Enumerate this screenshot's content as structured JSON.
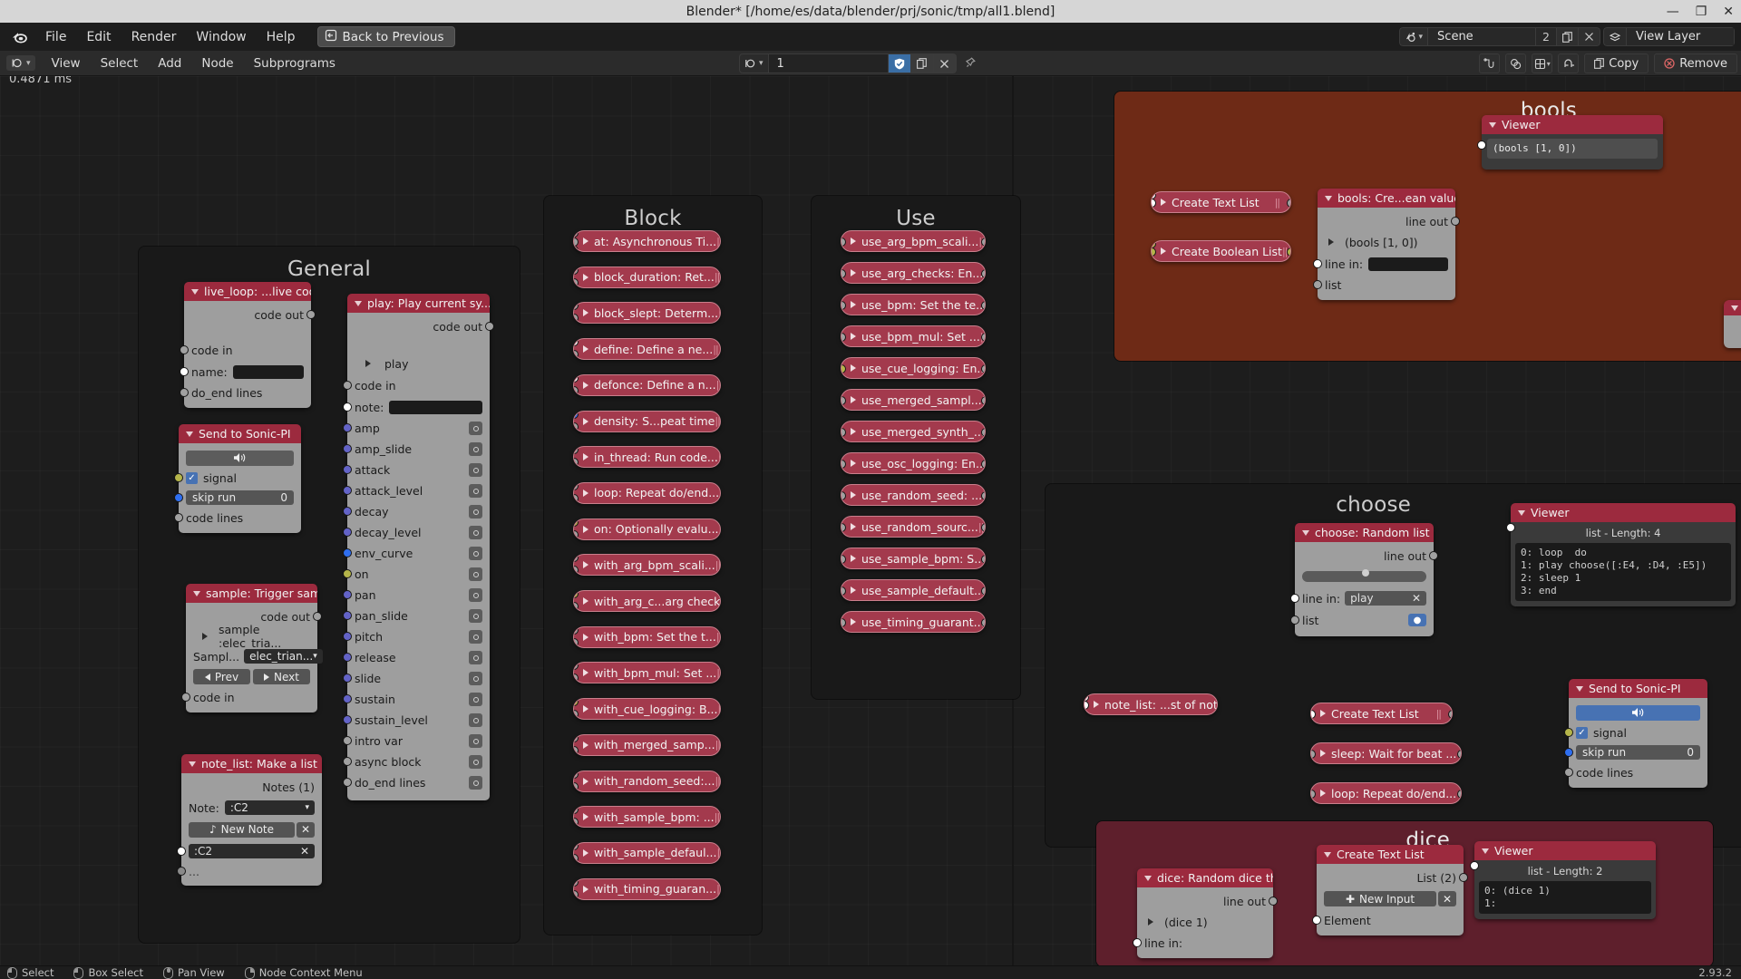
{
  "window": {
    "title": "Blender* [/home/es/data/blender/prj/sonic/tmp/all1.blend]",
    "minimize": "—",
    "maximize": "❐",
    "close": "✕"
  },
  "topbar": {
    "menus": [
      "File",
      "Edit",
      "Render",
      "Window",
      "Help"
    ],
    "back_button": "Back to Previous",
    "scene_name": "Scene",
    "scene_users": "2",
    "scene_copy_icon": "copy-icon",
    "scene_delete_icon": "x-icon",
    "view_layer_name": "View Layer"
  },
  "editor_header": {
    "menus": [
      "View",
      "Select",
      "Add",
      "Node",
      "Subprograms"
    ],
    "nodetree_name": "1",
    "fake_user_icon": "shield-icon",
    "new_copy_icon": "copy-icon",
    "unlink_icon": "x-icon",
    "pin_icon": "pin-icon",
    "copy_label": "Copy",
    "remove_label": "Remove"
  },
  "canvas": {
    "timing_label": "0.4871 ms"
  },
  "statusbar": {
    "items": [
      "Select",
      "Box Select",
      "Pan View",
      "Node Context Menu"
    ],
    "version": "2.93.2"
  },
  "frames": {
    "general": {
      "title": "General"
    },
    "block": {
      "title": "Block"
    },
    "use": {
      "title": "Use"
    },
    "bools": {
      "title": "bools"
    },
    "choose": {
      "title": "choose"
    },
    "dice": {
      "title": "dice"
    }
  },
  "nodes": {
    "live_loop": {
      "title": "live_loop: ...live coding",
      "out_code": "code out",
      "in_code": "code in",
      "name_label": "name:",
      "name_value": "",
      "do_end": "do_end lines"
    },
    "send_sonic_pi_1": {
      "title": "Send to Sonic-PI",
      "play_icon": "speaker-icon",
      "signal_label": "signal",
      "signal_checked": true,
      "skip_run_label": "skip run",
      "skip_run_value": "0",
      "code_lines": "code lines"
    },
    "sample": {
      "title": "sample: Trigger sam...",
      "out_code": "code out",
      "expand_label": "sample :elec_tria...",
      "sample_label": "Sampl...",
      "sample_value": "elec_trian...",
      "prev_label": "Prev",
      "next_label": "Next",
      "in_code": "code in"
    },
    "note_list": {
      "title": "note_list: Make a list ...",
      "notes_count": "Notes (1)",
      "note_label": "Note:",
      "note_value": ":C2",
      "new_note_label": "New Note",
      "item_value": ":C2",
      "more": "..."
    },
    "play": {
      "title": "play: Play current sy...",
      "out_code": "code out",
      "expand_label": "play",
      "in_code": "code in",
      "note_label": "note:",
      "note_value": "",
      "params": [
        "amp",
        "amp_slide",
        "attack",
        "attack_level",
        "decay",
        "decay_level",
        "env_curve",
        "on",
        "pan",
        "pan_slide",
        "pitch",
        "release",
        "slide",
        "sustain",
        "sustain_level",
        "intro var",
        "async block",
        "do_end lines"
      ]
    },
    "bools_node": {
      "title": "bools: Cre...ean values",
      "line_out": "line out",
      "value": "(bools [1, 0])",
      "line_in_label": "line in:",
      "line_in_value": "",
      "list_label": "list"
    },
    "bools_viewer": {
      "title": "Viewer",
      "text": "(bools [1, 0])"
    },
    "create_text_list_bools": {
      "title": "Create Text List"
    },
    "create_boolean_list": {
      "title": "Create Boolean List"
    },
    "choose_node": {
      "title": "choose: Random list ...",
      "line_out": "line out",
      "line_in_label": "line in:",
      "line_in_value": "play",
      "list_label": "list"
    },
    "choose_viewer": {
      "title": "Viewer",
      "subtitle": "list - Length: 4",
      "text": "0: loop  do\n1: play choose([:E4, :D4, :E5])\n2: sleep 1\n3: end"
    },
    "note_list_choose": {
      "title": "note_list: ...st of notes"
    },
    "create_text_list_choose": {
      "title": "Create Text List"
    },
    "sleep_node": {
      "title": "sleep: Wait for beat ..."
    },
    "loop_node": {
      "title": "loop: Repeat do/end..."
    },
    "send_sonic_pi_2": {
      "title": "Send to Sonic-PI",
      "signal_label": "signal",
      "signal_checked": true,
      "skip_run_label": "skip run",
      "skip_run_value": "0",
      "code_lines": "code lines"
    },
    "dice_node": {
      "title": "dice: Random dice th...",
      "line_out": "line out",
      "value": "(dice 1)",
      "line_in_label": "line in:"
    },
    "dice_create_text_list": {
      "title": "Create Text List",
      "list_label": "List (2)",
      "new_input_label": "New Input",
      "element_label": "Element"
    },
    "dice_viewer": {
      "title": "Viewer",
      "subtitle": "list - Length: 2",
      "text": "0: (dice 1)\n1:"
    }
  },
  "block_nodes": [
    {
      "label": "at: Asynchronous Ti...",
      "socks": [
        "grey",
        "grey",
        "grey"
      ]
    },
    {
      "label": "block_duration: Ret...",
      "socks": [
        "grey",
        "grey"
      ]
    },
    {
      "label": "block_slept: Determ...",
      "socks": [
        "grey",
        "grey"
      ]
    },
    {
      "label": "define: Define a ne...",
      "socks": [
        "white",
        "grey"
      ]
    },
    {
      "label": "defonce: Define a n...",
      "socks": [
        "white",
        "grey"
      ]
    },
    {
      "label": "density: S...peat time",
      "socks": [
        "blue",
        "grey"
      ]
    },
    {
      "label": "in_thread: Run code...",
      "socks": [
        "grey",
        "grey"
      ]
    },
    {
      "label": "loop: Repeat do/end...",
      "socks": [
        "grey",
        "grey"
      ]
    },
    {
      "label": "on: Optionally evalu...",
      "socks": [
        "olive",
        "grey"
      ]
    },
    {
      "label": "with_arg_bpm_scali...",
      "socks": [
        "grey",
        "grey"
      ]
    },
    {
      "label": "with_arg_c...arg checks",
      "socks": [
        "olive",
        "grey"
      ]
    },
    {
      "label": "with_bpm: Set the t...",
      "socks": [
        "grey",
        "grey"
      ]
    },
    {
      "label": "with_bpm_mul: Set ...",
      "socks": [
        "grey",
        "grey"
      ]
    },
    {
      "label": "with_cue_logging: B...",
      "socks": [
        "olive",
        "grey"
      ]
    },
    {
      "label": "with_merged_samp...",
      "socks": [
        "grey",
        "grey"
      ]
    },
    {
      "label": "with_random_seed:...",
      "socks": [
        "grey",
        "grey"
      ]
    },
    {
      "label": "with_sample_bpm: ...",
      "socks": [
        "grey",
        "grey"
      ]
    },
    {
      "label": "with_sample_defaul...",
      "socks": [
        "grey",
        "grey"
      ]
    },
    {
      "label": "with_timing_guaran...",
      "socks": [
        "grey",
        "grey"
      ]
    }
  ],
  "use_nodes": [
    {
      "label": "use_arg_bpm_scali...",
      "socks": [
        "grey"
      ]
    },
    {
      "label": "use_arg_checks: En...",
      "socks": [
        "grey"
      ]
    },
    {
      "label": "use_bpm: Set the te...",
      "socks": [
        "grey"
      ]
    },
    {
      "label": "use_bpm_mul: Set ...",
      "socks": [
        "grey"
      ]
    },
    {
      "label": "use_cue_logging: En...",
      "socks": [
        "olive"
      ]
    },
    {
      "label": "use_merged_sampl...",
      "socks": [
        "grey"
      ]
    },
    {
      "label": "use_merged_synth_...",
      "socks": [
        "grey"
      ]
    },
    {
      "label": "use_osc_logging: En...",
      "socks": [
        "grey"
      ]
    },
    {
      "label": "use_random_seed: ...",
      "socks": [
        "grey"
      ]
    },
    {
      "label": "use_random_sourc...",
      "socks": [
        "grey"
      ]
    },
    {
      "label": "use_sample_bpm: S...",
      "socks": [
        "grey"
      ]
    },
    {
      "label": "use_sample_default...",
      "socks": [
        "grey"
      ]
    },
    {
      "label": "use_timing_guarant...",
      "socks": [
        "grey"
      ]
    }
  ],
  "colors": {
    "node_header": "#9c2a3e",
    "node_body": "#9e9e9e",
    "frame_red": "#6e2a16",
    "frame_darkred": "#5e1f2c",
    "accent_blue": "#4772b3",
    "canvas_bg": "#1d1d1d"
  }
}
